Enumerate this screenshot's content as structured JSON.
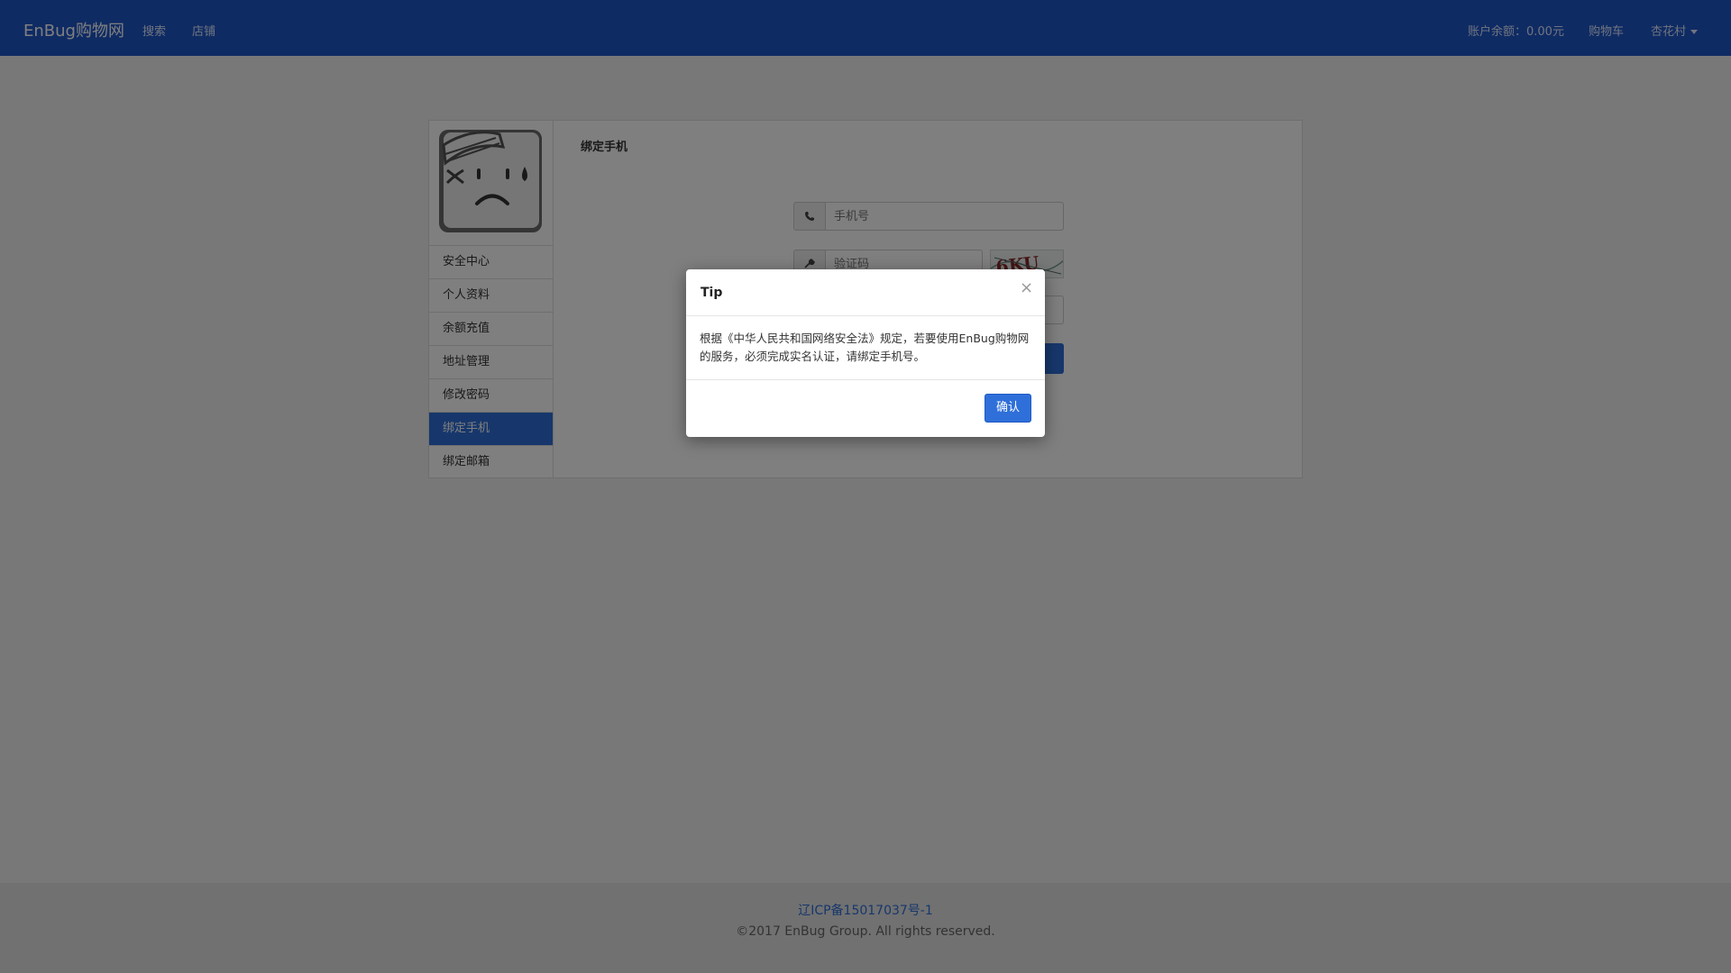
{
  "navbar": {
    "brand": "EnBug购物网",
    "links": [
      "搜索",
      "店铺"
    ],
    "balance": "账户余额：0.00元",
    "cart": "购物车",
    "user": "杏花村"
  },
  "sidebar": {
    "items": [
      {
        "label": "安全中心",
        "active": false
      },
      {
        "label": "个人资料",
        "active": false
      },
      {
        "label": "余额充值",
        "active": false
      },
      {
        "label": "地址管理",
        "active": false
      },
      {
        "label": "修改密码",
        "active": false
      },
      {
        "label": "绑定手机",
        "active": true
      },
      {
        "label": "绑定邮箱",
        "active": false
      }
    ]
  },
  "content": {
    "title": "绑定手机",
    "phone_placeholder": "手机号",
    "code_placeholder": "验证码",
    "captcha_text": "6KU"
  },
  "modal": {
    "title": "Tip",
    "close": "×",
    "body": "根据《中华人民共和国网络安全法》规定，若要使用EnBug购物网的服务，必须完成实名认证，请绑定手机号。",
    "confirm": "确认"
  },
  "footer": {
    "icp": "辽ICP备15017037号-1",
    "copyright": "©2017 EnBug Group. All rights reserved."
  },
  "colors": {
    "navbar": "#1e56c8",
    "accent": "#2f6fd9"
  }
}
